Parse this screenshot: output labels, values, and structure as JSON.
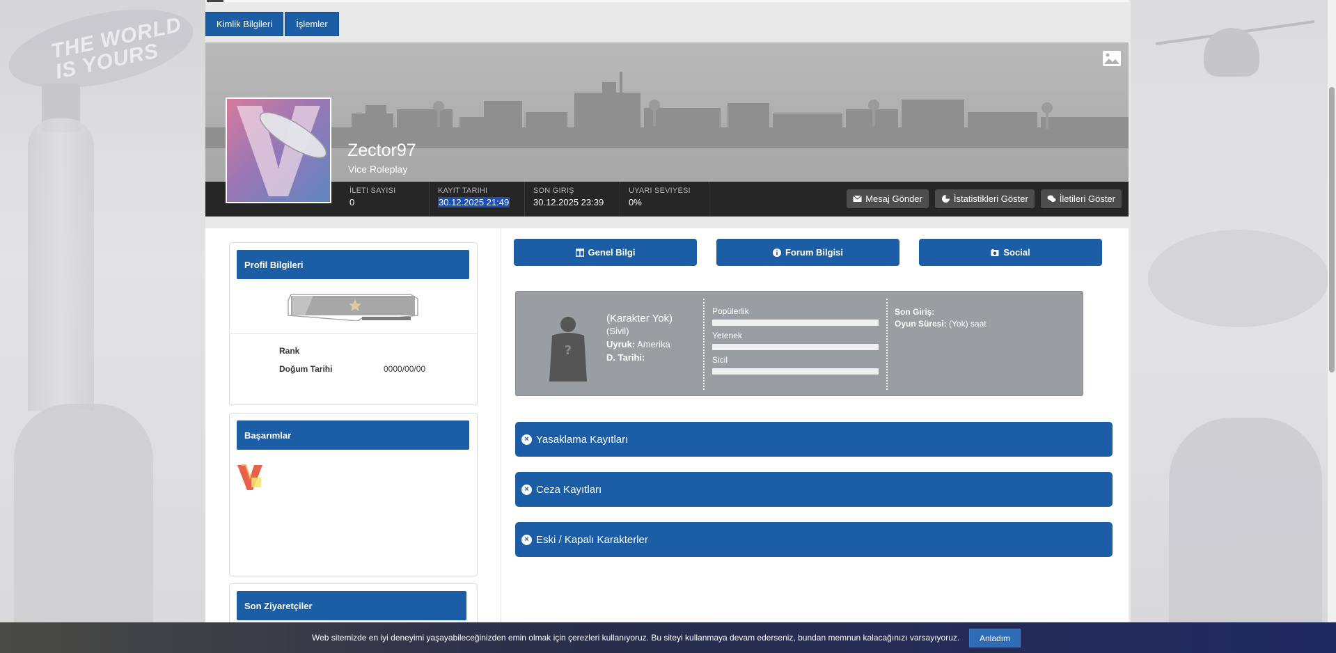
{
  "top_tabs": [
    "Kimlik Bilgileri",
    "İşlemler"
  ],
  "profile": {
    "username": "Zector97",
    "subtitle": "Vice Roleplay"
  },
  "stats": [
    {
      "label": "İleti Sayısı",
      "value": "0"
    },
    {
      "label": "Kayıt Tarihi",
      "value": "30.12.2025 21:49"
    },
    {
      "label": "Son Giriş",
      "value": "30.12.2025 23:39"
    },
    {
      "label": "Uyarı Seviyesi",
      "value": "0%"
    }
  ],
  "actions": {
    "message": "Mesaj Gönder",
    "stats": "İstatistikleri Göster",
    "posts": "İletileri Göster"
  },
  "left": {
    "profile_header": "Profil Bilgileri",
    "rank_label": "Rank",
    "rank_value": "",
    "birth_label": "Doğum Tarihi",
    "birth_value": "0000/00/00",
    "achievements_header": "Başarımlar",
    "visitors_header": "Son Ziyaretçiler"
  },
  "info_tabs": [
    "Genel Bilgi",
    "Forum Bilgisi",
    "Social"
  ],
  "character": {
    "name": "(Karakter Yok)",
    "role": "(Sivil)",
    "nationality_label": "Uyruk:",
    "nationality_value": "Amerika",
    "dob_label": "D. Tarihi:",
    "dob_value": "",
    "bars": [
      "Popülerlik",
      "Yetenek",
      "Sicil"
    ],
    "last_login_label": "Son Giriş:",
    "last_login_value": "",
    "playtime_label": "Oyun Süresi:",
    "playtime_value": "(Yok) saat"
  },
  "accordions": [
    "Yasaklama Kayıtları",
    "Ceza Kayıtları",
    "Eski / Kapalı Karakterler"
  ],
  "cookie": {
    "text": "Web sitemizde en iyi deneyimi yaşayabileceğinizden emin olmak için çerezleri kullanıyoruz. Bu siteyi kullanmaya devam ederseniz, bundan memnun kalacağınızı varsayıyoruz.",
    "button": "Anladım"
  },
  "colors": {
    "primary": "#1c5ea6",
    "statsbar": "#262626",
    "highlight": "#1d4fb3"
  }
}
